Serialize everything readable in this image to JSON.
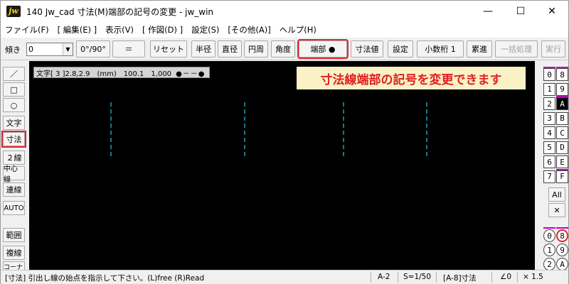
{
  "window": {
    "title": "140 Jw_cad 寸法(M)端部の記号の変更 - jw_win",
    "icon_label": "jw",
    "minimize": "—",
    "maximize": "☐",
    "close": "✕"
  },
  "menu": [
    "ファイル(F)",
    "[ 編集(E) ]",
    "表示(V)",
    "[ 作図(D) ]",
    "設定(S)",
    "[その他(A)]",
    "ヘルプ(H)"
  ],
  "toolbar": {
    "tilt_label": "傾き",
    "tilt_value": "0",
    "angle_button": "0°/90°",
    "equal_button": "＝",
    "reset_button": "リセット",
    "radius_button": "半径",
    "diameter_button": "直径",
    "circumference_button": "円周",
    "angle_dim_button": "角度",
    "end_button": "端部 ●",
    "dim_value_button": "寸法値",
    "settings_button": "設定",
    "decimal_button": "小数桁 1",
    "cumulative_button": "累進",
    "batch_button": "一括処理",
    "execute_button": "実行"
  },
  "left_tools": [
    "／",
    "□",
    "○",
    "文字",
    "寸法",
    "２線",
    "中心線",
    "連線",
    "AUTO",
    "範囲",
    "複線",
    "コーナー"
  ],
  "canvas": {
    "info_text": "文字[ 3 ]2.8,2.9　(mm)　100.1　1,000",
    "info_dots": "●－－●",
    "tooltip": "寸法線端部の記号を変更できます",
    "line_color": "#2ec4d6"
  },
  "layers": {
    "left": [
      "0",
      "1",
      "2",
      "3",
      "4",
      "5",
      "6",
      "7"
    ],
    "right": [
      "8",
      "9",
      "A",
      "B",
      "C",
      "D",
      "E",
      "F"
    ],
    "all_label": "All",
    "x_label": "✕",
    "group_left": [
      "0",
      "1",
      "2"
    ],
    "group_right": [
      "8",
      "9",
      "A"
    ]
  },
  "status": {
    "message": "[寸法] 引出し線の始点を指示して下さい。(L)free (R)Read",
    "paper": "A-2",
    "scale": "S=1/50",
    "layer": "[A-8]寸法",
    "angle": "∠0",
    "zoom": "× 1.5"
  },
  "colors": {
    "accent_red": "#e0262e",
    "tooltip_bg": "#fbf1c6",
    "layer_mark": "#c000c0"
  }
}
